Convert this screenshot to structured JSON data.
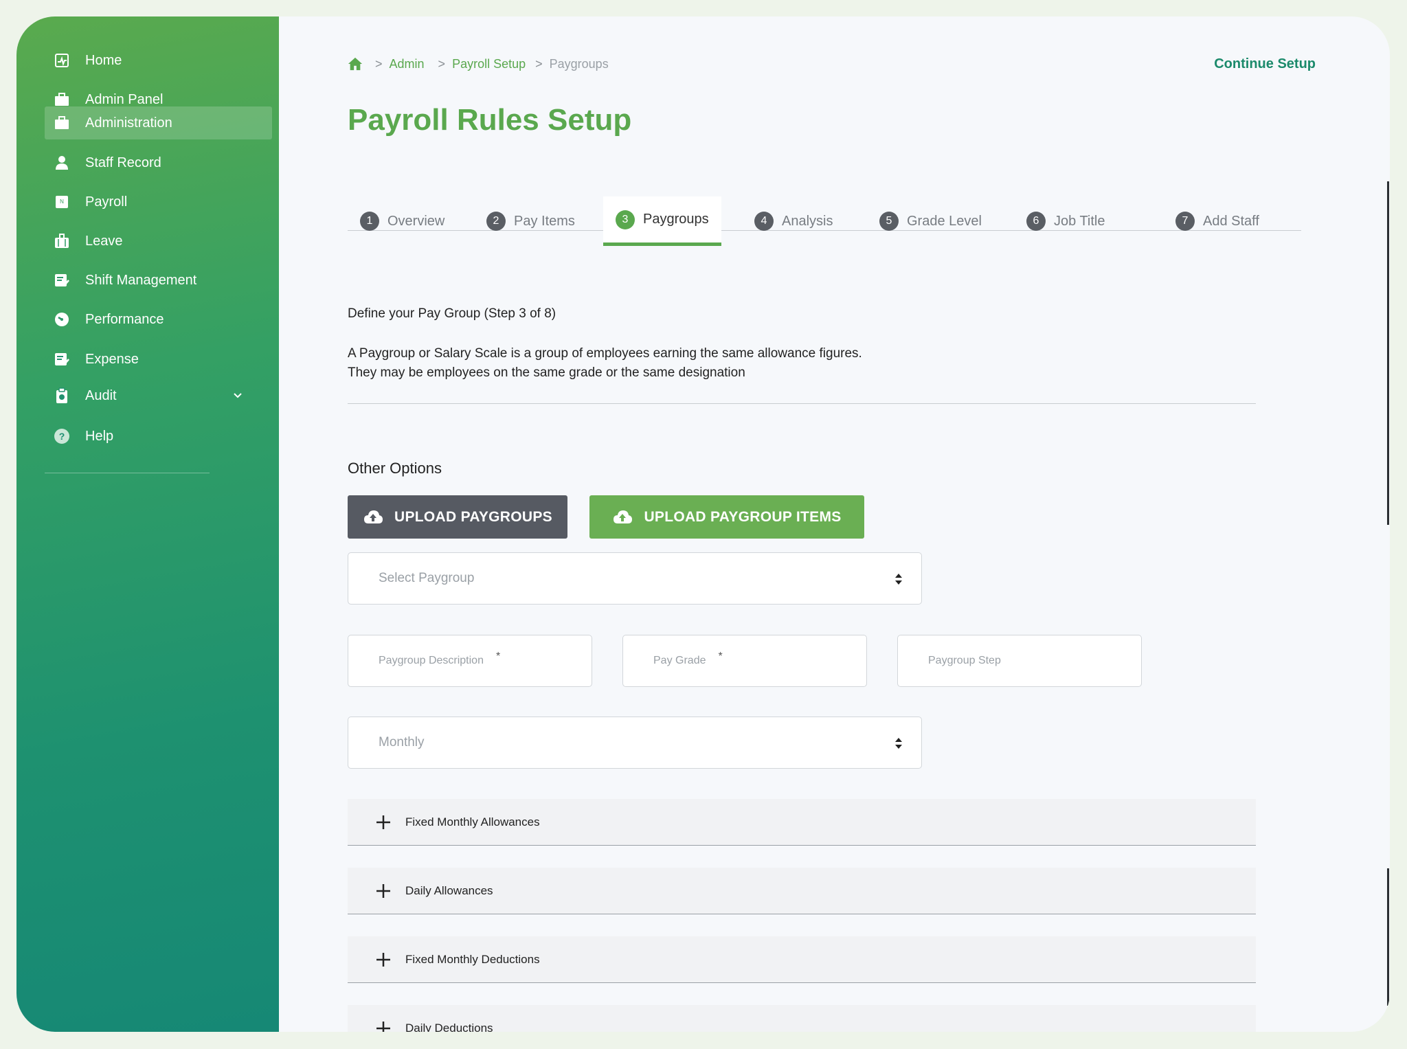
{
  "sidebar": {
    "items": [
      {
        "label": "Home",
        "icon": "dashboard-icon"
      },
      {
        "label": "Admin Panel",
        "icon": "briefcase-icon"
      },
      {
        "label": "Administration",
        "icon": "briefcase-icon",
        "active": true
      },
      {
        "label": "Staff Record",
        "icon": "user-icon"
      },
      {
        "label": "Payroll",
        "icon": "payroll-icon"
      },
      {
        "label": "Leave",
        "icon": "luggage-icon"
      },
      {
        "label": "Shift Management",
        "icon": "edit-check-icon"
      },
      {
        "label": "Performance",
        "icon": "gauge-icon"
      },
      {
        "label": "Expense",
        "icon": "edit-check-icon"
      },
      {
        "label": "Audit",
        "icon": "clipboard-icon",
        "expandable": true
      },
      {
        "label": "Help",
        "icon": "help-icon"
      }
    ]
  },
  "breadcrumb": {
    "items": [
      "Admin",
      "Payroll Setup",
      "Paygroups"
    ]
  },
  "header": {
    "continue_label": "Continue Setup",
    "title": "Payroll Rules Setup"
  },
  "tabs": [
    {
      "num": "1",
      "label": "Overview"
    },
    {
      "num": "2",
      "label": "Pay Items"
    },
    {
      "num": "3",
      "label": "Paygroups",
      "active": true
    },
    {
      "num": "4",
      "label": "Analysis"
    },
    {
      "num": "5",
      "label": "Grade Level"
    },
    {
      "num": "6",
      "label": "Job Title"
    },
    {
      "num": "7",
      "label": "Add Staff"
    }
  ],
  "content": {
    "step_text": "Define your Pay Group (Step 3 of 8)",
    "desc_line1": "A Paygroup or Salary Scale is a group of employees earning the same allowance figures.",
    "desc_line2": "They may be employees on the same grade or the same designation",
    "other_options": "Other Options"
  },
  "buttons": {
    "upload_paygroups": "UPLOAD PAYGROUPS",
    "upload_paygroup_items": "UPLOAD PAYGROUP ITEMS"
  },
  "form": {
    "select_paygroup_placeholder": "Select Paygroup",
    "description_placeholder": "Paygroup Description",
    "pay_grade_placeholder": "Pay Grade",
    "step_placeholder": "Paygroup Step",
    "required_mark": "*",
    "frequency_value": "Monthly"
  },
  "accordions": [
    "Fixed Monthly Allowances",
    "Daily Allowances",
    "Fixed Monthly Deductions",
    "Daily Deductions"
  ],
  "colors": {
    "brand_green": "#5aa84e",
    "teal": "#1b8a6b",
    "dark_button": "#565a62"
  }
}
